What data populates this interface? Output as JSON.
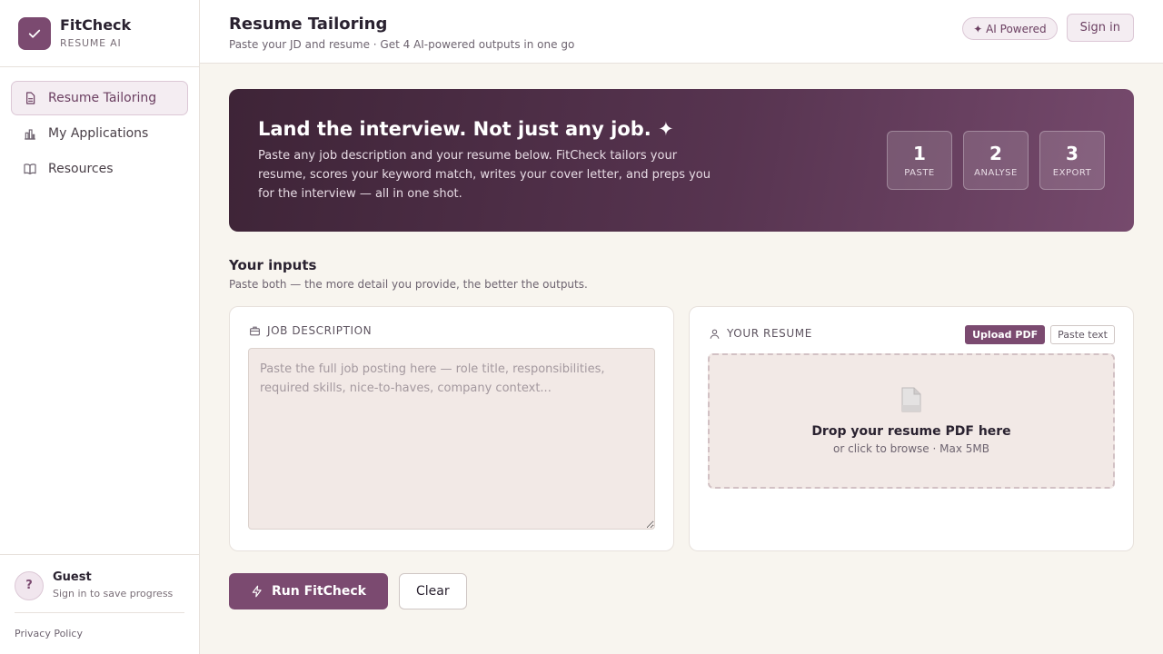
{
  "brand": {
    "name": "FitCheck",
    "subtitle": "RESUME AI",
    "logo_icon": "check-icon",
    "accent_color": "#7b4a70"
  },
  "sidebar": {
    "items": [
      {
        "label": "Resume Tailoring",
        "icon": "document-icon",
        "active": true
      },
      {
        "label": "My Applications",
        "icon": "bar-chart-icon",
        "active": false
      },
      {
        "label": "Resources",
        "icon": "book-icon",
        "active": false
      }
    ],
    "guest": {
      "avatar": "?",
      "name": "Guest",
      "subtitle": "Sign in to save progress"
    },
    "privacy_label": "Privacy Policy"
  },
  "header": {
    "title": "Resume Tailoring",
    "subtitle": "Paste your JD and resume · Get 4 AI-powered outputs in one go",
    "ai_badge": "✦ AI Powered",
    "signin_label": "Sign in"
  },
  "hero": {
    "title": "Land the interview. Not just any job. ✦",
    "description": "Paste any job description and your resume below. FitCheck tailors your resume, scores your keyword match, writes your cover letter, and preps you for the interview — all in one shot.",
    "steps": [
      {
        "num": "1",
        "label": "PASTE"
      },
      {
        "num": "2",
        "label": "ANALYSE"
      },
      {
        "num": "3",
        "label": "EXPORT"
      }
    ]
  },
  "inputs": {
    "heading": "Your inputs",
    "subtitle": "Paste both — the more detail you provide, the better the outputs."
  },
  "job_description": {
    "label": "JOB DESCRIPTION",
    "icon": "briefcase-icon",
    "value": "",
    "placeholder": "Paste the full job posting here — role title, responsibilities, required skills, nice-to-haves, company context..."
  },
  "resume": {
    "label": "YOUR RESUME",
    "icon": "user-icon",
    "upload_label": "Upload PDF",
    "paste_label": "Paste text",
    "drop_icon": "file-icon",
    "drop_title": "Drop your resume PDF here",
    "drop_sub": "or click to browse · Max 5MB"
  },
  "actions": {
    "run_label": "Run FitCheck",
    "run_icon": "lightning-icon",
    "clear_label": "Clear"
  }
}
